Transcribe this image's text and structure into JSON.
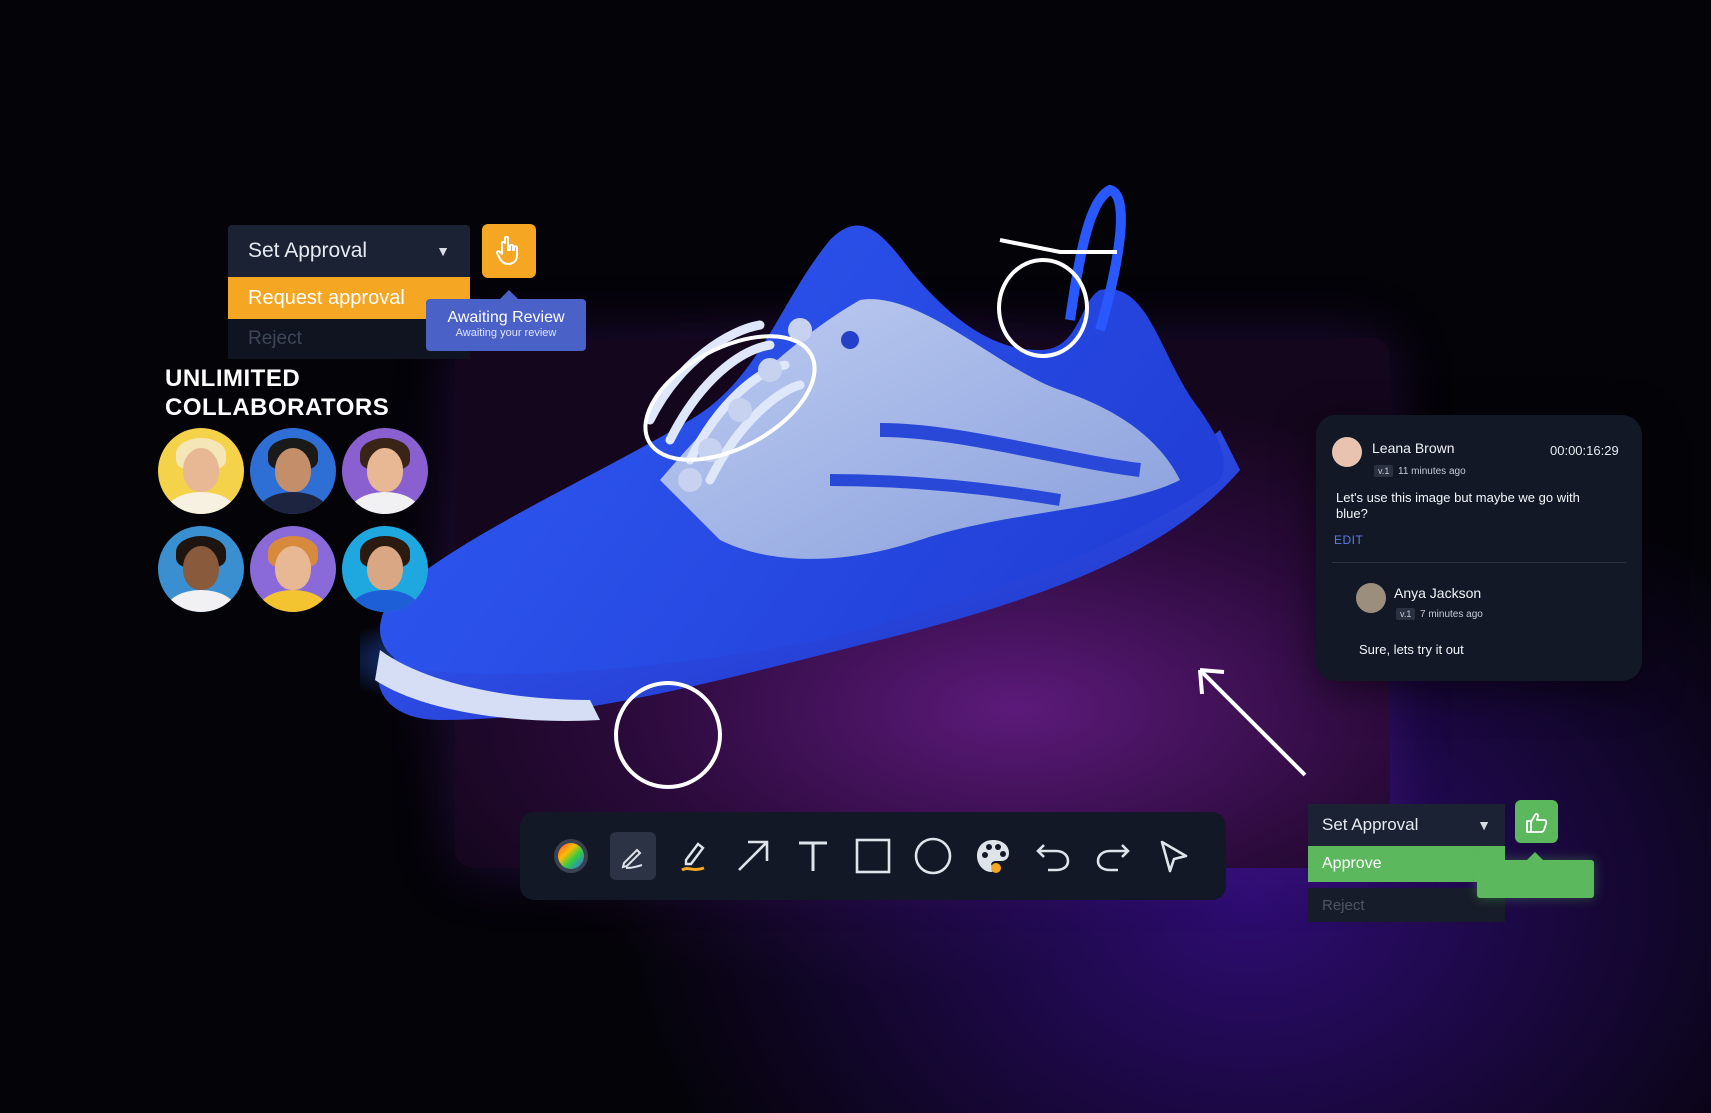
{
  "approval_top": {
    "select_label": "Set Approval",
    "options": [
      "Request approval",
      "Reject"
    ],
    "button_icon": "pointer-hand-icon",
    "tooltip_title": "Awaiting Review",
    "tooltip_subtitle": "Awaiting your review",
    "accent": "#f5a623"
  },
  "collaborators": {
    "title_line1": "UNLIMITED",
    "title_line2": "COLLABORATORS",
    "avatar_colors": [
      "#f4d24a",
      "#2e6fd6",
      "#8a5fd0",
      "#3a8fd0",
      "#8a6ad8",
      "#1fa7e0"
    ]
  },
  "comments": {
    "items": [
      {
        "author": "Leana Brown",
        "version": "v.1",
        "time": "11 minutes ago",
        "timecode": "00:00:16:29",
        "text_line1": "Let's use this image but maybe we go with",
        "text_line2": "blue?",
        "edit_label": "EDIT"
      },
      {
        "author": "Anya Jackson",
        "version": "v.1",
        "time": "7 minutes ago",
        "text": "Sure, lets try it out"
      }
    ]
  },
  "toolbar": {
    "tools": [
      "color-wheel-icon",
      "pen-icon",
      "highlighter-icon",
      "arrow-icon",
      "text-icon",
      "rectangle-icon",
      "ellipse-icon",
      "palette-icon",
      "undo-icon",
      "redo-icon",
      "select-pointer-icon"
    ],
    "active_tool": "pen-icon"
  },
  "approval_bottom": {
    "select_label": "Set Approval",
    "options": [
      "Approve",
      "Reject"
    ],
    "button_icon": "thumbs-up-hand-icon",
    "accent": "#5cb85c"
  }
}
